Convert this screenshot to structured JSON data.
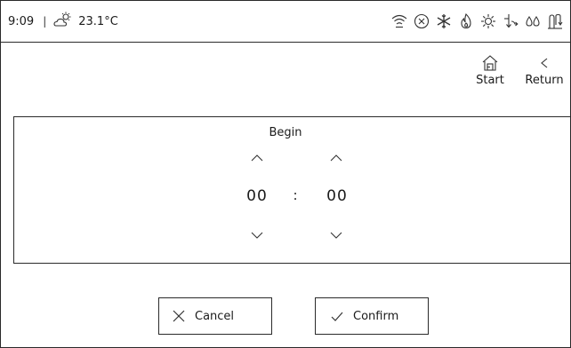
{
  "status": {
    "time": "9:09",
    "separator": "|",
    "temperature": "23.1°C",
    "icons": [
      "weather-partly-sunny-icon",
      "wifi-icon",
      "close-circle-icon",
      "snowflake-icon",
      "flame-icon",
      "defrost-icon",
      "pump-arrows-icon",
      "water-drops-icon",
      "heat-exchanger-icon"
    ]
  },
  "nav": {
    "start_label": "Start",
    "return_label": "Return"
  },
  "timer": {
    "title": "Begin",
    "hours": "00",
    "separator": ":",
    "minutes": "00"
  },
  "actions": {
    "cancel_label": "Cancel",
    "confirm_label": "Confirm"
  }
}
